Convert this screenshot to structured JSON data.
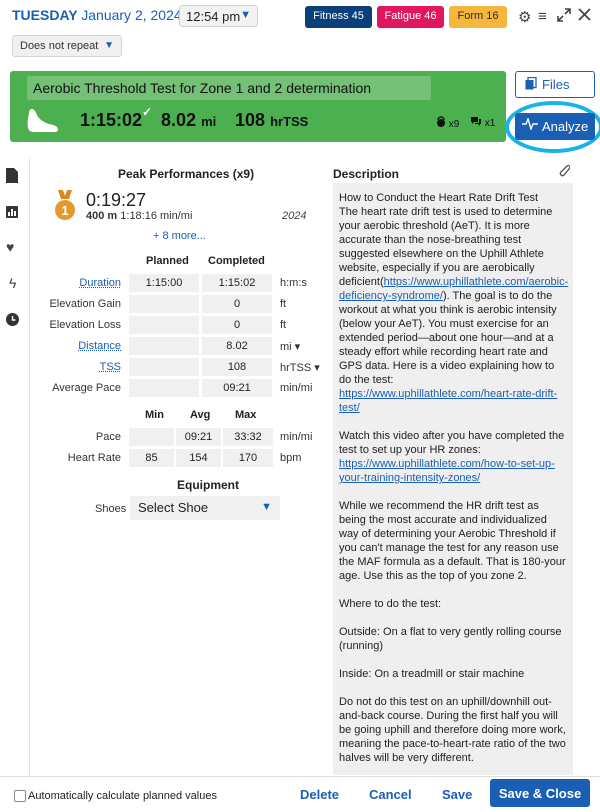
{
  "header": {
    "day": "TUESDAY",
    "date": "January 2, 2024",
    "time": "12:54 pm",
    "badges": [
      {
        "label": "Fitness 45",
        "color": "#0b3f7a"
      },
      {
        "label": "Fatigue 46",
        "color": "#e0175f"
      },
      {
        "label": "Form 16",
        "color": "#f6b73c"
      }
    ],
    "icons": [
      "gear-icon",
      "menu-icon",
      "expand-icon",
      "close-icon"
    ],
    "repeat": "Does not repeat"
  },
  "workout": {
    "title": "Aerobic Threshold Test for Zone 1 and 2 determination",
    "duration": "1:15:02",
    "distance": "8.02",
    "distance_unit": "mi",
    "tss": "108",
    "tss_unit": "hrTSS",
    "equipment_count": "x9",
    "comments_count": "x1",
    "card_color": "#4caf50"
  },
  "buttons": {
    "files": "Files",
    "analyze": "Analyze"
  },
  "peak": {
    "title": "Peak Performances (x9)",
    "time": "0:19:27",
    "distance": "400 m",
    "pace": "1:18:16 min/mi",
    "year": "2024",
    "rank": "1",
    "more": "+ 8 more..."
  },
  "table": {
    "planned_header": "Planned",
    "completed_header": "Completed",
    "rows": [
      {
        "label": "Duration",
        "planned": "1:15:00",
        "completed": "1:15:02",
        "unit": "h:m:s"
      },
      {
        "label": "Elevation Gain",
        "planned": "",
        "completed": "0",
        "unit": "ft"
      },
      {
        "label": "Elevation Loss",
        "planned": "",
        "completed": "0",
        "unit": "ft"
      },
      {
        "label": "Distance",
        "planned": "",
        "completed": "8.02",
        "unit": "mi ▾"
      },
      {
        "label": "TSS",
        "planned": "",
        "completed": "108",
        "unit": "hrTSS ▾"
      },
      {
        "label": "Average Pace",
        "planned": "",
        "completed": "09:21",
        "unit": "min/mi"
      }
    ]
  },
  "minmax": {
    "min_header": "Min",
    "avg_header": "Avg",
    "max_header": "Max",
    "rows": [
      {
        "label": "Pace",
        "min": "",
        "avg": "09:21",
        "max": "33:32",
        "unit": "min/mi"
      },
      {
        "label": "Heart Rate",
        "min": "85",
        "avg": "154",
        "max": "170",
        "unit": "bpm"
      }
    ]
  },
  "equipment": {
    "title": "Equipment",
    "shoes_label": "Shoes",
    "shoes_value": "Select Shoe"
  },
  "description": {
    "title": "Description",
    "p1": "How to Conduct the Heart Rate Drift Test\nThe heart rate drift test is used to determine your aerobic threshold (AeT). It is more accurate than the nose-breathing test suggested elsewhere on the Uphill Athlete website, especially if you are aerobically deficient(",
    "link1": "https://www.uphillathlete.com/aerobic-deficiency-syndrome/",
    "p2": "). The goal is to do the workout at what you think is aerobic intensity (below your AeT). You must exercise for an extended period—about one hour—and at a steady effort while recording heart rate and GPS data. Here is a video explaining how to do the test: ",
    "link2": "https://www.uphillathlete.com/heart-rate-drift-test/",
    "p3": "\n\nWatch this video after you have completed the test to set up your HR zones:\n",
    "link3": "https://www.uphillathlete.com/how-to-set-up-your-training-intensity-zones/",
    "p4": "\n\nWhile we recommend the HR drift test as being the most accurate and individualized way of determining your Aerobic Threshold if you can't manage the test for any reason use the MAF formula as a default. That is 180-your age. Use this as the top of you zone 2.\n\nWhere to do the test:\n\nOutside: On a flat to very gently rolling course (running)\n\nInside: On a treadmill or stair machine\n\nDo not do this test on an uphill/downhill out-and-back course. During the first half you will be going uphill and therefore doing more work, meaning the pace-to-heart-rate ratio of the two halves will be very different.\n\nWhat you will need:\nA GPS-enabled watch or phone\nA chest strap heart rate monitor that pairs with your watch or phone (we recommend against"
  },
  "footer": {
    "auto_calc": "Automatically calculate planned values",
    "delete": "Delete",
    "cancel": "Cancel",
    "save": "Save",
    "save_close": "Save & Close"
  }
}
